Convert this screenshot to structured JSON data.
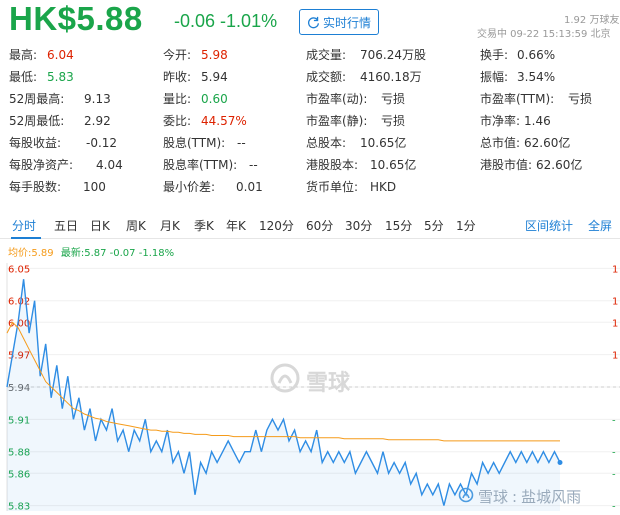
{
  "header": {
    "price": "HK$5.88",
    "change": "-0.06",
    "change_pct": "-1.01%",
    "realtime_label": "实时行情",
    "followers": "1.92 万球友",
    "trade_time": "交易中 09-22 15:13:59 北京"
  },
  "stats": {
    "col1": [
      {
        "label": "最高:",
        "value": "6.04",
        "color": "red"
      },
      {
        "label": "最低:",
        "value": "5.83",
        "color": "green"
      },
      {
        "label": "52周最高:",
        "value": "9.13",
        "color": ""
      },
      {
        "label": "52周最低:",
        "value": "2.92",
        "color": ""
      },
      {
        "label": "每股收益:",
        "value": "-0.12",
        "color": ""
      },
      {
        "label": "每股净资产:",
        "value": "4.04",
        "color": ""
      },
      {
        "label": "每手股数:",
        "value": "100",
        "color": ""
      }
    ],
    "col2": [
      {
        "label": "今开:",
        "value": "5.98",
        "color": "red"
      },
      {
        "label": "昨收:",
        "value": "5.94",
        "color": ""
      },
      {
        "label": "量比:",
        "value": "0.60",
        "color": "green"
      },
      {
        "label": "委比:",
        "value": "44.57%",
        "color": "red"
      },
      {
        "label": "股息(TTM):",
        "value": "--",
        "color": ""
      },
      {
        "label": "股息率(TTM):",
        "value": "--",
        "color": ""
      },
      {
        "label": "最小价差:",
        "value": "0.01",
        "color": ""
      }
    ],
    "col3": [
      {
        "label": "成交量:",
        "value": "706.24万股",
        "color": ""
      },
      {
        "label": "成交额:",
        "value": "4160.18万",
        "color": ""
      },
      {
        "label": "市盈率(动):",
        "value": "亏损",
        "color": ""
      },
      {
        "label": "市盈率(静):",
        "value": "亏损",
        "color": ""
      },
      {
        "label": "总股本:",
        "value": "10.65亿",
        "color": ""
      },
      {
        "label": "港股股本:",
        "value": "10.65亿",
        "color": ""
      },
      {
        "label": "货币单位:",
        "value": "HKD",
        "color": ""
      }
    ],
    "col4": [
      {
        "label": "换手:",
        "value": "0.66%",
        "color": ""
      },
      {
        "label": "振幅:",
        "value": "3.54%",
        "color": ""
      },
      {
        "label": "市盈率(TTM):",
        "value": "亏损",
        "color": ""
      },
      {
        "label": "市净率:",
        "value": "1.46",
        "color": ""
      },
      {
        "label": "总市值:",
        "value": "62.60亿",
        "color": ""
      },
      {
        "label": "港股市值:",
        "value": "62.60亿",
        "color": ""
      }
    ]
  },
  "tabs": {
    "items": [
      "分时",
      "五日",
      "日K",
      "周K",
      "月K",
      "季K",
      "年K",
      "120分",
      "60分",
      "30分",
      "15分",
      "5分",
      "1分"
    ],
    "active": "分时",
    "range_stats": "区间统计",
    "fullscreen": "全屏"
  },
  "legend": {
    "avg_label": "均价:",
    "avg_value": "5.89",
    "last_label": "最新:",
    "last_value": "5.87",
    "last_change": "-0.07",
    "last_change_pct": "-1.18%"
  },
  "watermark": {
    "text": "雪球"
  },
  "credit": {
    "brand": "雪球",
    "author": "盐城风雨"
  },
  "colors": {
    "down_green": "#1aa54a",
    "up_red": "#dd2200",
    "accent_blue": "#1d7fd4",
    "avg_orange": "#f59b1a",
    "price_line": "#2f8de4"
  },
  "chart_data": {
    "type": "line",
    "title": "",
    "xlabel": "",
    "ylabel": "",
    "ylim": [
      5.825,
      6.055
    ],
    "y_ticks_left": [
      "6.05",
      "6.02",
      "6.00",
      "5.97",
      "5.94",
      "5.91",
      "5.88",
      "5.86",
      "5.83"
    ],
    "reference_close": 5.94,
    "series": [
      {
        "name": "最新",
        "color": "#2f8de4",
        "values": [
          5.94,
          5.97,
          6.0,
          6.04,
          5.99,
          6.02,
          5.95,
          5.98,
          5.93,
          5.96,
          5.92,
          5.95,
          5.91,
          5.93,
          5.9,
          5.92,
          5.89,
          5.91,
          5.9,
          5.92,
          5.89,
          5.9,
          5.88,
          5.9,
          5.89,
          5.91,
          5.88,
          5.89,
          5.88,
          5.9,
          5.87,
          5.88,
          5.86,
          5.88,
          5.84,
          5.87,
          5.86,
          5.88,
          5.87,
          5.88,
          5.89,
          5.88,
          5.87,
          5.88,
          5.88,
          5.9,
          5.88,
          5.9,
          5.91,
          5.9,
          5.91,
          5.89,
          5.9,
          5.88,
          5.89,
          5.88,
          5.9,
          5.87,
          5.88,
          5.87,
          5.88,
          5.87,
          5.88,
          5.86,
          5.87,
          5.88,
          5.87,
          5.86,
          5.88,
          5.86,
          5.87,
          5.86,
          5.87,
          5.85,
          5.86,
          5.84,
          5.85,
          5.84,
          5.85,
          5.83,
          5.85,
          5.84,
          5.85,
          5.84,
          5.86,
          5.85,
          5.87,
          5.86,
          5.87,
          5.86,
          5.87,
          5.88,
          5.87,
          5.88,
          5.87,
          5.88,
          5.87,
          5.88,
          5.87,
          5.88,
          5.87
        ]
      },
      {
        "name": "均价",
        "color": "#f59b1a",
        "values": [
          5.99,
          6.0,
          5.995,
          5.985,
          5.975,
          5.965,
          5.955,
          5.945,
          5.94,
          5.935,
          5.93,
          5.925,
          5.92,
          5.918,
          5.915,
          5.913,
          5.911,
          5.91,
          5.908,
          5.907,
          5.906,
          5.905,
          5.904,
          5.903,
          5.902,
          5.901,
          5.9,
          5.9,
          5.899,
          5.899,
          5.898,
          5.898,
          5.897,
          5.897,
          5.896,
          5.896,
          5.896,
          5.895,
          5.895,
          5.895,
          5.895,
          5.894,
          5.894,
          5.894,
          5.894,
          5.894,
          5.894,
          5.894,
          5.894,
          5.894,
          5.894,
          5.894,
          5.894,
          5.893,
          5.893,
          5.893,
          5.893,
          5.893,
          5.893,
          5.893,
          5.893,
          5.892,
          5.892,
          5.892,
          5.892,
          5.892,
          5.892,
          5.892,
          5.892,
          5.891,
          5.891,
          5.891,
          5.891,
          5.891,
          5.891,
          5.891,
          5.891,
          5.891,
          5.891,
          5.89,
          5.89,
          5.89,
          5.89,
          5.89,
          5.89,
          5.89,
          5.89,
          5.89,
          5.89,
          5.89,
          5.89,
          5.89,
          5.89,
          5.89,
          5.89,
          5.89,
          5.89,
          5.89,
          5.89,
          5.89,
          5.89
        ]
      }
    ]
  }
}
